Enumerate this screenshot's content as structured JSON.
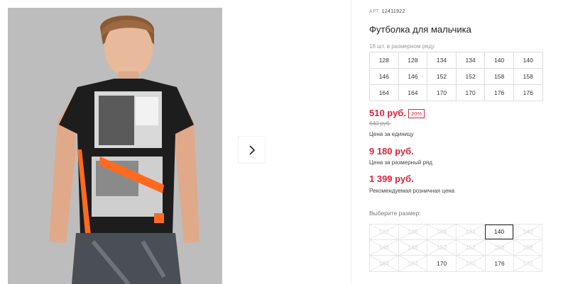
{
  "product": {
    "art_label": "АРТ.",
    "art_value": "12411922",
    "title": "Футболка для мальчика",
    "pack_note": "18 шт. в размерном ряду"
  },
  "pack_sizes": [
    [
      "128",
      "128",
      "134",
      "134",
      "140",
      "140"
    ],
    [
      "146",
      "146",
      "152",
      "152",
      "158",
      "158"
    ],
    [
      "164",
      "164",
      "170",
      "170",
      "176",
      "176"
    ]
  ],
  "prices": {
    "unit_price": "510 руб.",
    "discount": "20%",
    "old_price": "640 руб.",
    "unit_caption": "Цена за единицу",
    "pack_price": "9 180 руб.",
    "pack_caption": "Цена за размерный ряд",
    "rrp_price": "1 399 руб.",
    "rrp_caption": "Рекомендуемая розничная цена"
  },
  "size_picker": {
    "label": "Выберите размер:",
    "rows": [
      [
        {
          "v": "128",
          "s": "na"
        },
        {
          "v": "128",
          "s": "na"
        },
        {
          "v": "134",
          "s": "na"
        },
        {
          "v": "134",
          "s": "na"
        },
        {
          "v": "140",
          "s": "selected"
        },
        {
          "v": "140",
          "s": "na"
        }
      ],
      [
        {
          "v": "146",
          "s": "na"
        },
        {
          "v": "146",
          "s": "na"
        },
        {
          "v": "152",
          "s": "na"
        },
        {
          "v": "152",
          "s": "na"
        },
        {
          "v": "158",
          "s": "na"
        },
        {
          "v": "158",
          "s": "na"
        }
      ],
      [
        {
          "v": "164",
          "s": "na"
        },
        {
          "v": "164",
          "s": "na"
        },
        {
          "v": "170",
          "s": "available"
        },
        {
          "v": "170",
          "s": "na"
        },
        {
          "v": "176",
          "s": "available"
        },
        {
          "v": "176",
          "s": "na"
        }
      ]
    ]
  },
  "gallery": {
    "next_icon": "chevron-right-icon",
    "photo": "boy-in-printed-tshirt"
  },
  "colors": {
    "price_red": "#d7263d",
    "photo_bg": "#b9b9b9"
  }
}
